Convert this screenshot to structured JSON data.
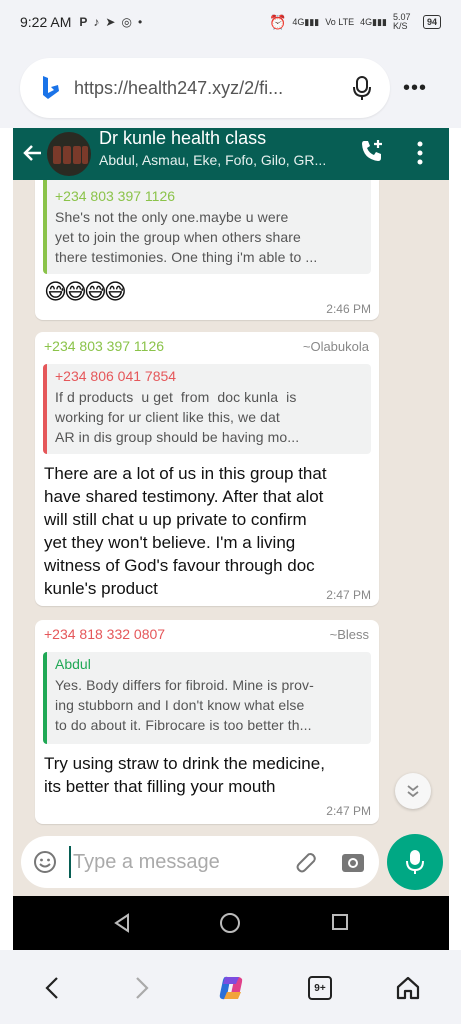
{
  "status_bar": {
    "time": "9:22 AM",
    "left_icons": [
      "P",
      "tiktok-icon",
      "telegram-icon",
      "whatsapp-icon",
      "•"
    ],
    "net_speed": "5.07 K/S",
    "battery": "94"
  },
  "browser": {
    "url": "https://health247.xyz/2/fi...",
    "bottom_nav": {
      "tabs_count": "9+"
    }
  },
  "chat": {
    "title": "Dr kunle health class",
    "members": "Abdul, Asmau, Eke, Fofo, Gilo, GR...",
    "messages": [
      {
        "quote_author": "+234 803 397 1126",
        "quote_lines": [
          "She's not the only one.maybe u were",
          "yet to join the group when others share",
          "there testimonies. One thing i'm able to ..."
        ],
        "emoji": "😅😅😅😅",
        "time": "2:46 PM"
      },
      {
        "sender": "+234 803 397 1126",
        "alias": "~Olabukola",
        "quote_author": "+234 806 041 7854",
        "quote_lines": [
          "If d products  u get  from  doc kunla  is",
          "working for ur client like this, we dat",
          "AR in dis group should be having mo..."
        ],
        "text_lines": [
          "There are a lot of us in this group that",
          "have shared testimony. After that alot",
          "will still chat u up private to confirm",
          "yet they won't believe. I'm a living",
          "witness of God's favour through doc",
          "kunle's product"
        ],
        "time": "2:47 PM"
      },
      {
        "sender": "+234 818 332 0807",
        "alias": "~Bless",
        "quote_author": "Abdul",
        "quote_lines": [
          "Yes. Body differs for fibroid. Mine is prov-",
          "ing stubborn and I don't know what else",
          "to do about it. Fibrocare is too better th..."
        ],
        "text_lines": [
          "Try using straw to drink the medicine,",
          "its better that filling your mouth"
        ],
        "time": "2:47 PM"
      }
    ],
    "input_placeholder": "Type a message"
  },
  "colors": {
    "header": "#075e54",
    "quote_green": "#8bc34a",
    "sender_green": "#8bc34a",
    "sender_red": "#e5575a",
    "author_green": "#1fa855",
    "voice": "#00a884"
  }
}
